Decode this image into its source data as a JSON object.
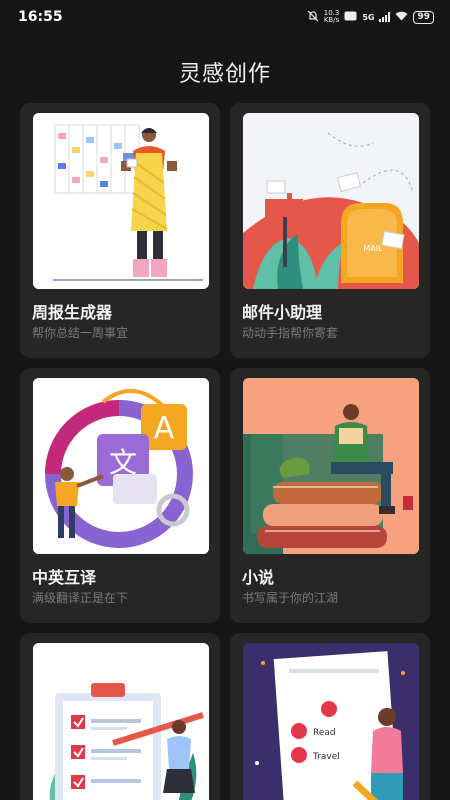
{
  "status": {
    "time": "16:55",
    "net_speed_top": "10.3",
    "net_speed_bottom": "KB/s",
    "network": "5G",
    "battery": "99"
  },
  "header": {
    "title": "灵感创作"
  },
  "cards": [
    {
      "title": "周报生成器",
      "subtitle": "帮你总结一周事宜"
    },
    {
      "title": "邮件小助理",
      "subtitle": "动动手指帮你寄套"
    },
    {
      "title": "中英互译",
      "subtitle": "满级翻译正是在下"
    },
    {
      "title": "小说",
      "subtitle": "书写属于你的江湖"
    }
  ],
  "illustrations": {
    "mail_box_text": "MAIL",
    "translate_a": "A",
    "translate_zh": "文",
    "list_item_2": "Read",
    "list_item_3": "Travel"
  },
  "colors": {
    "background": "#161616",
    "card": "#262626",
    "subtitle": "#7a7a7a"
  }
}
